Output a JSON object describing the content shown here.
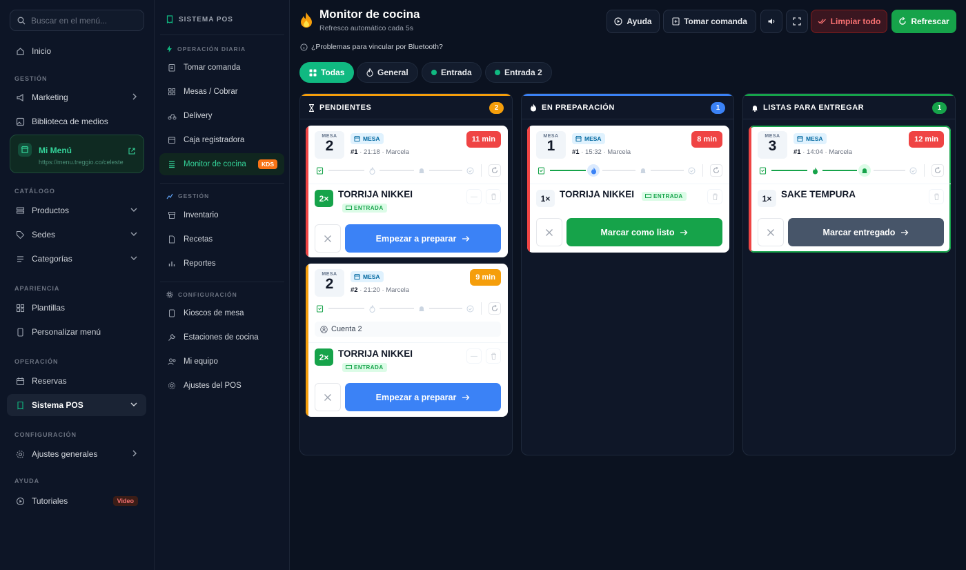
{
  "sidebar": {
    "search_placeholder": "Buscar en el menú...",
    "inicio": "Inicio",
    "gestion_label": "GESTIÓN",
    "marketing": "Marketing",
    "biblioteca": "Biblioteca de medios",
    "mi_menu": {
      "title": "Mi Menú",
      "url": "https://menu.treggio.co/celeste"
    },
    "catalogo_label": "CATÁLOGO",
    "productos": "Productos",
    "sedes": "Sedes",
    "categorias": "Categorías",
    "apariencia_label": "APARIENCIA",
    "plantillas": "Plantillas",
    "personalizar": "Personalizar menú",
    "operacion_label": "OPERACIÓN",
    "reservas": "Reservas",
    "sistema_pos": "Sistema POS",
    "configuracion_label": "CONFIGURACIÓN",
    "ajustes_generales": "Ajustes generales",
    "ayuda_label": "AYUDA",
    "tutoriales": "Tutoriales",
    "video_badge": "Video"
  },
  "pos_nav": {
    "title": "SISTEMA POS",
    "operacion_label": "OPERACIÓN DIARIA",
    "tomar_comanda": "Tomar comanda",
    "mesas": "Mesas / Cobrar",
    "delivery": "Delivery",
    "caja": "Caja registradora",
    "monitor": "Monitor de cocina",
    "kds": "KDS",
    "gestion_label": "GESTIÓN",
    "inventario": "Inventario",
    "recetas": "Recetas",
    "reportes": "Reportes",
    "config_label": "CONFIGURACIÓN",
    "kioscos": "Kioscos de mesa",
    "estaciones": "Estaciones de cocina",
    "equipo": "Mi equipo",
    "ajustes_pos": "Ajustes del POS"
  },
  "header": {
    "title": "Monitor de cocina",
    "subtitle": "Refresco automático cada 5s",
    "bluetooth": "¿Problemas para vincular por Bluetooth?",
    "ayuda": "Ayuda",
    "tomar_comanda": "Tomar comanda",
    "limpiar": "Limpiar todo",
    "refrescar": "Refrescar"
  },
  "filters": {
    "todas": "Todas",
    "general": "General",
    "entrada": "Entrada",
    "entrada2": "Entrada 2"
  },
  "columns": {
    "pendientes": {
      "title": "PENDIENTES",
      "count": "2",
      "color": "#f59e0b"
    },
    "preparacion": {
      "title": "EN PREPARACIÓN",
      "count": "1",
      "color": "#3b82f6"
    },
    "listas": {
      "title": "LISTAS PARA ENTREGAR",
      "count": "1",
      "color": "#16a34a"
    }
  },
  "cards": {
    "p1": {
      "mesa_label": "MESA",
      "mesa": "2",
      "badge": "MESA",
      "num": "#1",
      "time": "21:18",
      "waiter": "Marcela",
      "timer": "11 min",
      "qty": "2×",
      "item": "TORRIJA NIKKEI",
      "station": "ENTRADA",
      "action": "Empezar a preparar"
    },
    "p2": {
      "mesa_label": "MESA",
      "mesa": "2",
      "badge": "MESA",
      "num": "#2",
      "time": "21:20",
      "waiter": "Marcela",
      "timer": "9 min",
      "cuenta": "Cuenta 2",
      "qty": "2×",
      "item": "TORRIJA NIKKEI",
      "station": "ENTRADA",
      "action": "Empezar a preparar"
    },
    "e1": {
      "mesa_label": "MESA",
      "mesa": "1",
      "badge": "MESA",
      "num": "#1",
      "time": "15:32",
      "waiter": "Marcela",
      "timer": "8 min",
      "qty": "1×",
      "item": "TORRIJA NIKKEI",
      "station": "ENTRADA",
      "action": "Marcar como listo"
    },
    "l1": {
      "mesa_label": "MESA",
      "mesa": "3",
      "badge": "MESA",
      "num": "#1",
      "time": "14:04",
      "waiter": "Marcela",
      "timer": "12 min",
      "qty": "1×",
      "item": "SAKE TEMPURA",
      "action": "Marcar entregado"
    }
  },
  "colors": {
    "accent": "#10b981",
    "red": "#ef4444",
    "amber": "#f59e0b",
    "blue": "#3b82f6",
    "green": "#16a34a",
    "slate": "#475569"
  }
}
